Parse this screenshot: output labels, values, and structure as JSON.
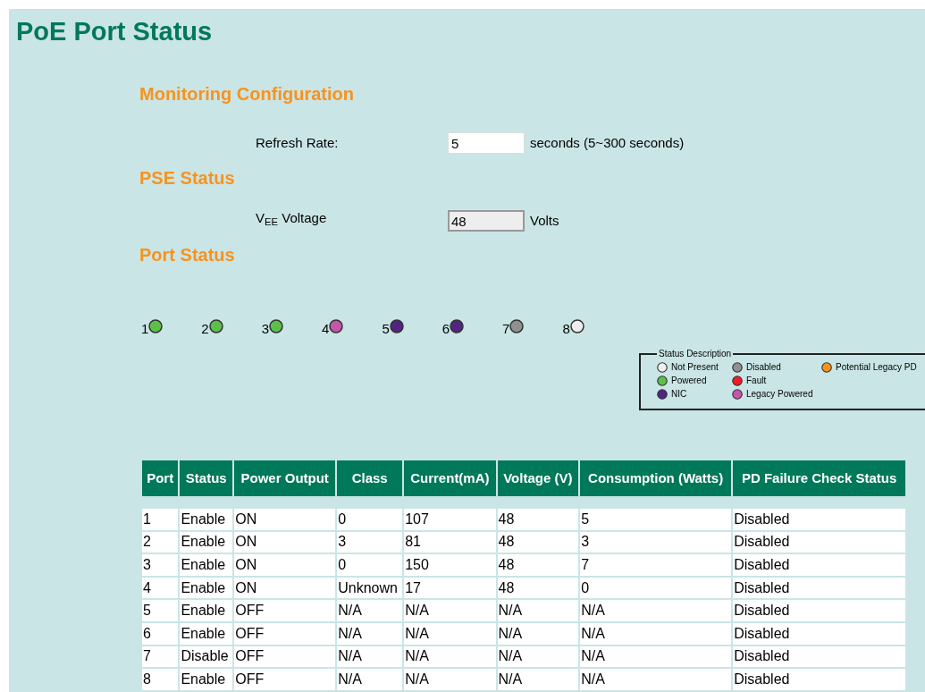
{
  "title": "PoE Port Status",
  "monitoring": {
    "heading": "Monitoring Configuration",
    "label": "Refresh Rate:",
    "value": "5",
    "unit": "seconds (5~300 seconds)"
  },
  "pse": {
    "heading": "PSE Status",
    "label": "V$_{EE}$ Voltage",
    "value": "48",
    "unit": "Volts",
    "disabled": true
  },
  "port_status": {
    "heading": "Port Status",
    "ports": [
      {
        "label": "1",
        "color": "#5cbf4a"
      },
      {
        "label": "2",
        "color": "#5cbf4a"
      },
      {
        "label": "3",
        "color": "#5cbf4a"
      },
      {
        "label": "4",
        "color": "#c555a8"
      },
      {
        "label": "5",
        "color": "#522582"
      },
      {
        "label": "6",
        "color": "#522582"
      },
      {
        "label": "7",
        "color": "#909090"
      },
      {
        "label": "8",
        "color": "#eeeeee"
      }
    ],
    "legend": {
      "title": "Status Description",
      "items": [
        {
          "label": "Not Present",
          "color": "#eeeeee"
        },
        {
          "label": "Powered",
          "color": "#5cbf4a"
        },
        {
          "label": "NIC",
          "color": "#522582"
        },
        {
          "label": "Disabled",
          "color": "#909090"
        },
        {
          "label": "Fault",
          "color": "#ee1c24"
        },
        {
          "label": "Legacy Powered",
          "color": "#c555a8"
        },
        {
          "label": "Potential Legacy PD",
          "color": "#f7931e"
        }
      ]
    }
  },
  "table": {
    "columns": [
      "Port",
      "Status",
      "Power Output",
      "Class",
      "Current(mA)",
      "Voltage (V)",
      "Consumption (Watts)",
      "PD Failure Check Status"
    ],
    "rows": [
      [
        "1",
        "Enable",
        "ON",
        "0",
        "107",
        "48",
        "5",
        "Disabled"
      ],
      [
        "2",
        "Enable",
        "ON",
        "3",
        "81",
        "48",
        "3",
        "Disabled"
      ],
      [
        "3",
        "Enable",
        "ON",
        "0",
        "150",
        "48",
        "7",
        "Disabled"
      ],
      [
        "4",
        "Enable",
        "ON",
        "Unknown",
        "17",
        "48",
        "0",
        "Disabled"
      ],
      [
        "5",
        "Enable",
        "OFF",
        "N/A",
        "N/A",
        "N/A",
        "N/A",
        "Disabled"
      ],
      [
        "6",
        "Enable",
        "OFF",
        "N/A",
        "N/A",
        "N/A",
        "N/A",
        "Disabled"
      ],
      [
        "7",
        "Disable",
        "OFF",
        "N/A",
        "N/A",
        "N/A",
        "N/A",
        "Disabled"
      ],
      [
        "8",
        "Enable",
        "OFF",
        "N/A",
        "N/A",
        "N/A",
        "N/A",
        "Disabled"
      ]
    ]
  }
}
